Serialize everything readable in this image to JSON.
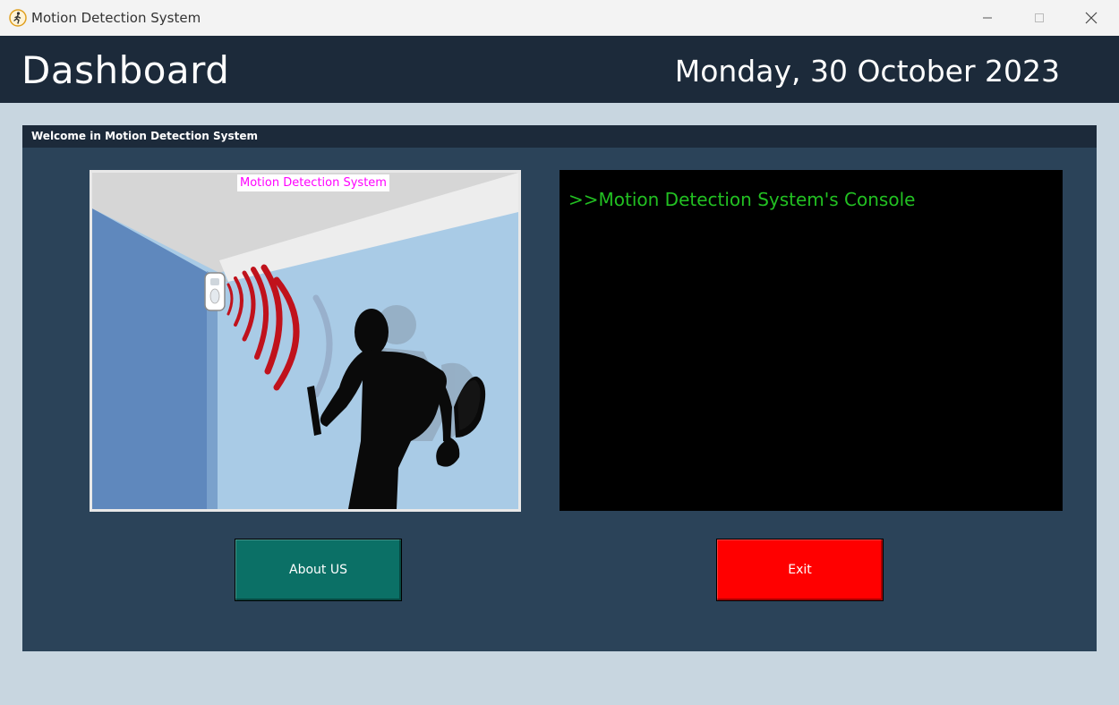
{
  "window": {
    "title": "Motion Detection System",
    "icon": "running-man-icon"
  },
  "header": {
    "title": "Dashboard",
    "date": "Monday, 30 October 2023"
  },
  "panel": {
    "header_text": "Welcome in Motion Detection System",
    "image_caption": "Motion Detection System",
    "console_text": ">>Motion Detection System's Console"
  },
  "buttons": {
    "about_label": "About US",
    "exit_label": "Exit"
  },
  "colors": {
    "header_bg": "#1c2a3a",
    "panel_bg": "#2b4359",
    "page_bg": "#c8d6e0",
    "about_button": "#0b7066",
    "exit_button": "#ff0000",
    "console_text": "#22c022",
    "caption_text": "#ff00ff"
  }
}
